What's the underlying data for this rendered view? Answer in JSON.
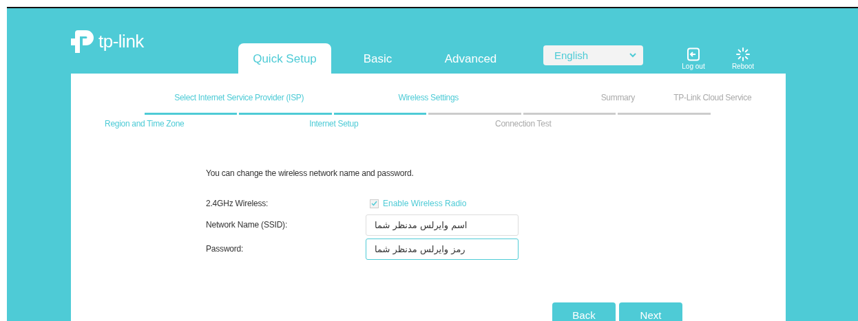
{
  "logo": {
    "text": "tp-link"
  },
  "tabs": [
    {
      "label": "Quick Setup",
      "selected": true
    },
    {
      "label": "Basic",
      "selected": false
    },
    {
      "label": "Advanced",
      "selected": false
    }
  ],
  "language": {
    "value": "English"
  },
  "actions": [
    {
      "label": "Log out",
      "kind": "logout"
    },
    {
      "label": "Reboot",
      "kind": "reboot"
    }
  ],
  "steps": [
    {
      "label": "Region and Time Zone",
      "done": true
    },
    {
      "label": "Select Internet Service Provider (ISP)",
      "done": true
    },
    {
      "label": "Internet Setup",
      "done": true
    },
    {
      "label": "Wireless Settings",
      "done": true
    },
    {
      "label": "Connection Test",
      "done": false
    },
    {
      "label": "Summary",
      "done": false
    },
    {
      "label": "TP-Link Cloud Service",
      "done": false
    }
  ],
  "intro": "You can change the wireless network name and password.",
  "wireless": {
    "label": "2.4GHz Wireless:",
    "option": "Enable Wireless Radio",
    "checked": true
  },
  "fields": [
    {
      "label": "Network Name (SSID):",
      "value": "اسم وایرلس مدنظر شما",
      "focused": false
    },
    {
      "label": "Password:",
      "value": "رمز وایرلس مدنظر شما",
      "focused": true
    }
  ],
  "buttons": [
    "Back",
    "Next"
  ]
}
